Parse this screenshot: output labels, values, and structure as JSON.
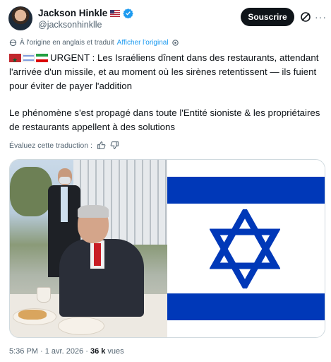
{
  "author": {
    "name": "Jackson Hinkle",
    "country_flag": "us-flag",
    "handle": "@jacksonhinklle",
    "verified": true
  },
  "actions": {
    "subscribe_label": "Souscrire"
  },
  "translation": {
    "note": "À l'origine en anglais et traduit",
    "show_original": "Afficher l'original"
  },
  "tweet": {
    "flags": [
      "morocco-flag",
      "israel-flag",
      "iran-flag"
    ],
    "paragraph1": "URGENT : Les Israéliens dînent dans des restaurants, attendant l'arrivée d'un missile, et au moment où les sirènes retentissent — ils fuient pour éviter de payer l'addition",
    "paragraph2": "Le phénomène s'est propagé dans toute l'Entité sioniste & les propriétaires de restaurants appellent à des solutions"
  },
  "rating": {
    "label": "Évaluez cette traduction :"
  },
  "footer": {
    "time_date": "5:36 PM · 1 avr. 2026 · ",
    "views_count": "36 k",
    "views_label": " vues"
  },
  "colors": {
    "accent": "#1d9bf0",
    "israel_blue": "#0038b8",
    "text_primary": "#0f1419",
    "text_secondary": "#536471"
  }
}
